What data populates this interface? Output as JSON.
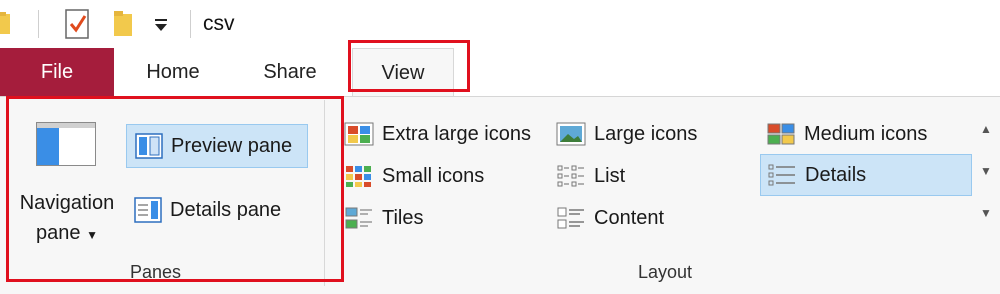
{
  "titlebar": {
    "title": "csv"
  },
  "tabs": [
    {
      "label": "File"
    },
    {
      "label": "Home"
    },
    {
      "label": "Share"
    },
    {
      "label": "View"
    }
  ],
  "panes": {
    "navigation_pane_line1": "Navigation",
    "navigation_pane_line2": "pane",
    "preview_pane": "Preview pane",
    "details_pane": "Details pane",
    "group_label": "Panes"
  },
  "layout": {
    "items": [
      {
        "label": "Extra large icons"
      },
      {
        "label": "Large icons"
      },
      {
        "label": "Medium icons"
      },
      {
        "label": "Small icons"
      },
      {
        "label": "List"
      },
      {
        "label": "Details",
        "selected": true
      },
      {
        "label": "Tiles"
      },
      {
        "label": "Content"
      }
    ],
    "group_label": "Layout"
  },
  "colors": {
    "file_tab": "#a51d3c",
    "highlight": "#e0101e",
    "selected_bg": "#cce4f7",
    "ribbon_bg": "#f7f7f7"
  }
}
